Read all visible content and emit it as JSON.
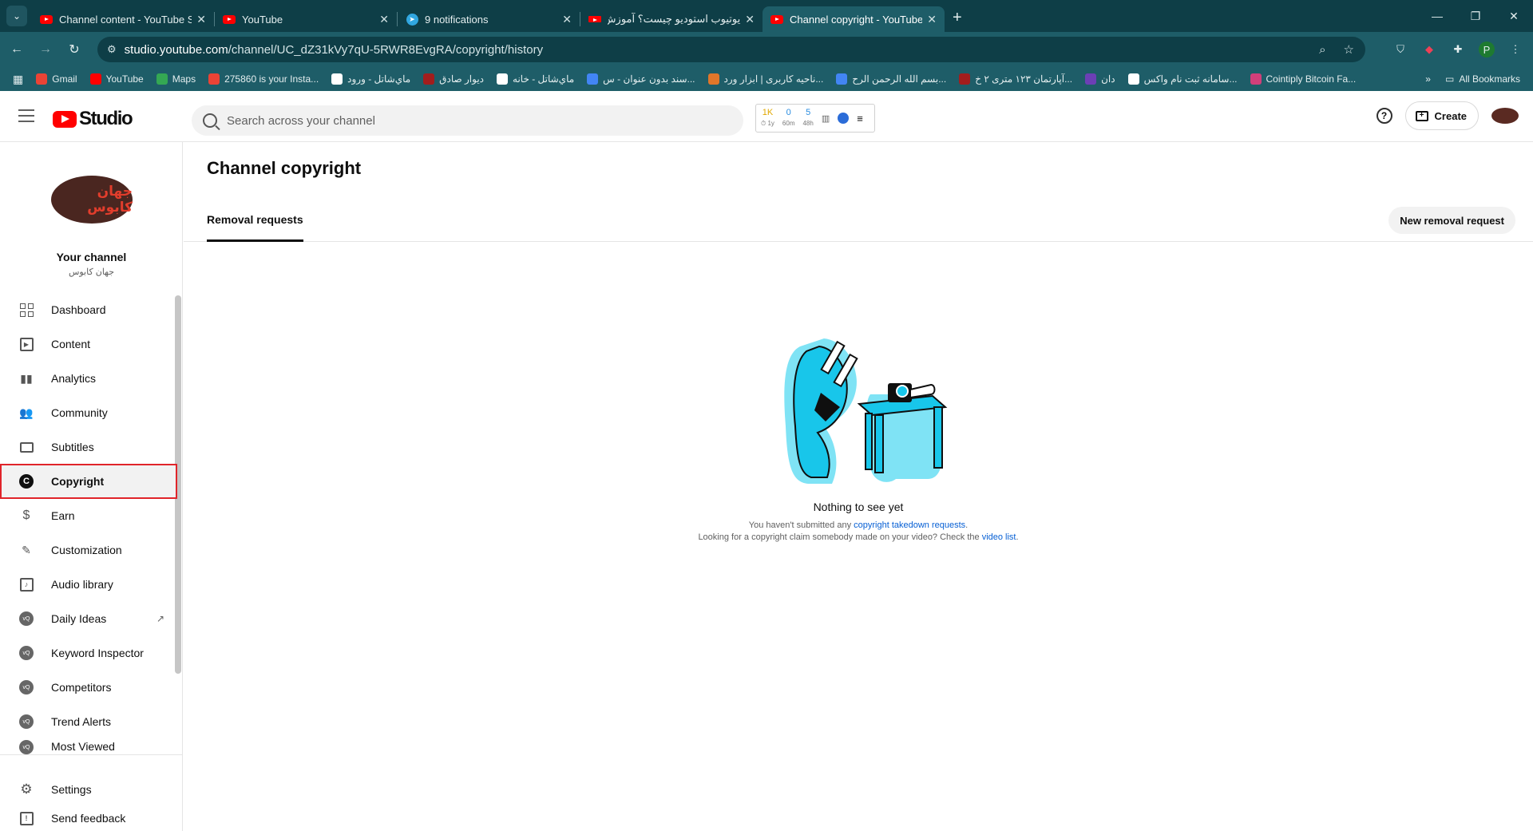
{
  "browser": {
    "tabs": [
      {
        "title": "Channel content - YouTube Stu",
        "favicon": "youtube-icon"
      },
      {
        "title": "YouTube",
        "favicon": "youtube-icon"
      },
      {
        "title": "9 notifications",
        "favicon": "telegram-icon"
      },
      {
        "title": "یوتیوب استودیو چیست؟ آموزش",
        "favicon": "site-icon"
      },
      {
        "title": "Channel copyright - YouTube St",
        "favicon": "youtube-icon"
      }
    ],
    "url_host": "studio.youtube.com",
    "url_path": "/channel/UC_dZ31kVy7qU-5RWR8EvgRA/copyright/history",
    "profile_initial": "P",
    "bookmarks": [
      {
        "label": "Gmail",
        "color": "#ea4335"
      },
      {
        "label": "YouTube",
        "color": "#ff0000"
      },
      {
        "label": "Maps",
        "color": "#34a853"
      },
      {
        "label": "275860 is your Insta...",
        "color": "#ea4335"
      },
      {
        "label": "ماي‌شاتل - ورود",
        "color": "#ffffff"
      },
      {
        "label": "دیوار صادق",
        "color": "#a21d1d"
      },
      {
        "label": "ماي‌شاتل - خانه",
        "color": "#ffffff"
      },
      {
        "label": "سند بدون عنوان - س...",
        "color": "#4285f4"
      },
      {
        "label": "ناحیه کاربری | ابزار ورد...",
        "color": "#e0762a"
      },
      {
        "label": "بسم الله الرحمن الرح...",
        "color": "#4285f4"
      },
      {
        "label": "آپارتمان ۱۲۳ متری ۲ خ...",
        "color": "#a21d1d"
      },
      {
        "label": "دان",
        "color": "#6c3fb5"
      },
      {
        "label": "سامانه ثبت نام واکس...",
        "color": "#ffffff"
      },
      {
        "label": "Cointiply Bitcoin Fa...",
        "color": "#d13f7a"
      }
    ],
    "all_bookmarks": "All Bookmarks"
  },
  "header": {
    "studio_label": "Studio",
    "search_placeholder": "Search across your channel",
    "vidiq_stats": [
      {
        "value": "1K",
        "sub": "⏱ 1y",
        "color": "#e0a800"
      },
      {
        "value": "0",
        "sub": "60m",
        "color": "#2b8de0"
      },
      {
        "value": "5",
        "sub": "48h",
        "color": "#2b8de0"
      }
    ],
    "create_label": "Create"
  },
  "sidebar": {
    "avatar_text": "جهان کابوس",
    "channel_title": "Your channel",
    "channel_subtitle": "جهان کابوس",
    "items": [
      {
        "label": "Dashboard",
        "icon": "dashboard-icon"
      },
      {
        "label": "Content",
        "icon": "content-icon"
      },
      {
        "label": "Analytics",
        "icon": "analytics-icon"
      },
      {
        "label": "Community",
        "icon": "community-icon"
      },
      {
        "label": "Subtitles",
        "icon": "subtitles-icon"
      },
      {
        "label": "Copyright",
        "icon": "copyright-icon",
        "active": true
      },
      {
        "label": "Earn",
        "icon": "earn-icon"
      },
      {
        "label": "Customization",
        "icon": "customization-icon"
      },
      {
        "label": "Audio library",
        "icon": "audio-library-icon"
      },
      {
        "label": "Daily Ideas",
        "icon": "vidiq-icon"
      },
      {
        "label": "Keyword Inspector",
        "icon": "vidiq-icon"
      },
      {
        "label": "Competitors",
        "icon": "vidiq-icon"
      },
      {
        "label": "Trend Alerts",
        "icon": "vidiq-icon"
      },
      {
        "label": "Most Viewed",
        "icon": "vidiq-icon"
      }
    ],
    "settings_label": "Settings",
    "feedback_label": "Send feedback"
  },
  "main": {
    "title": "Channel copyright",
    "tab_label": "Removal requests",
    "new_request_label": "New removal request",
    "empty_title": "Nothing to see yet",
    "empty_line1_prefix": "You haven't submitted any ",
    "empty_line1_link": "copyright takedown requests",
    "empty_line1_suffix": ".",
    "empty_line2_prefix": "Looking for a copyright claim somebody made on your video? Check the ",
    "empty_line2_link": "video list",
    "empty_line2_suffix": "."
  }
}
